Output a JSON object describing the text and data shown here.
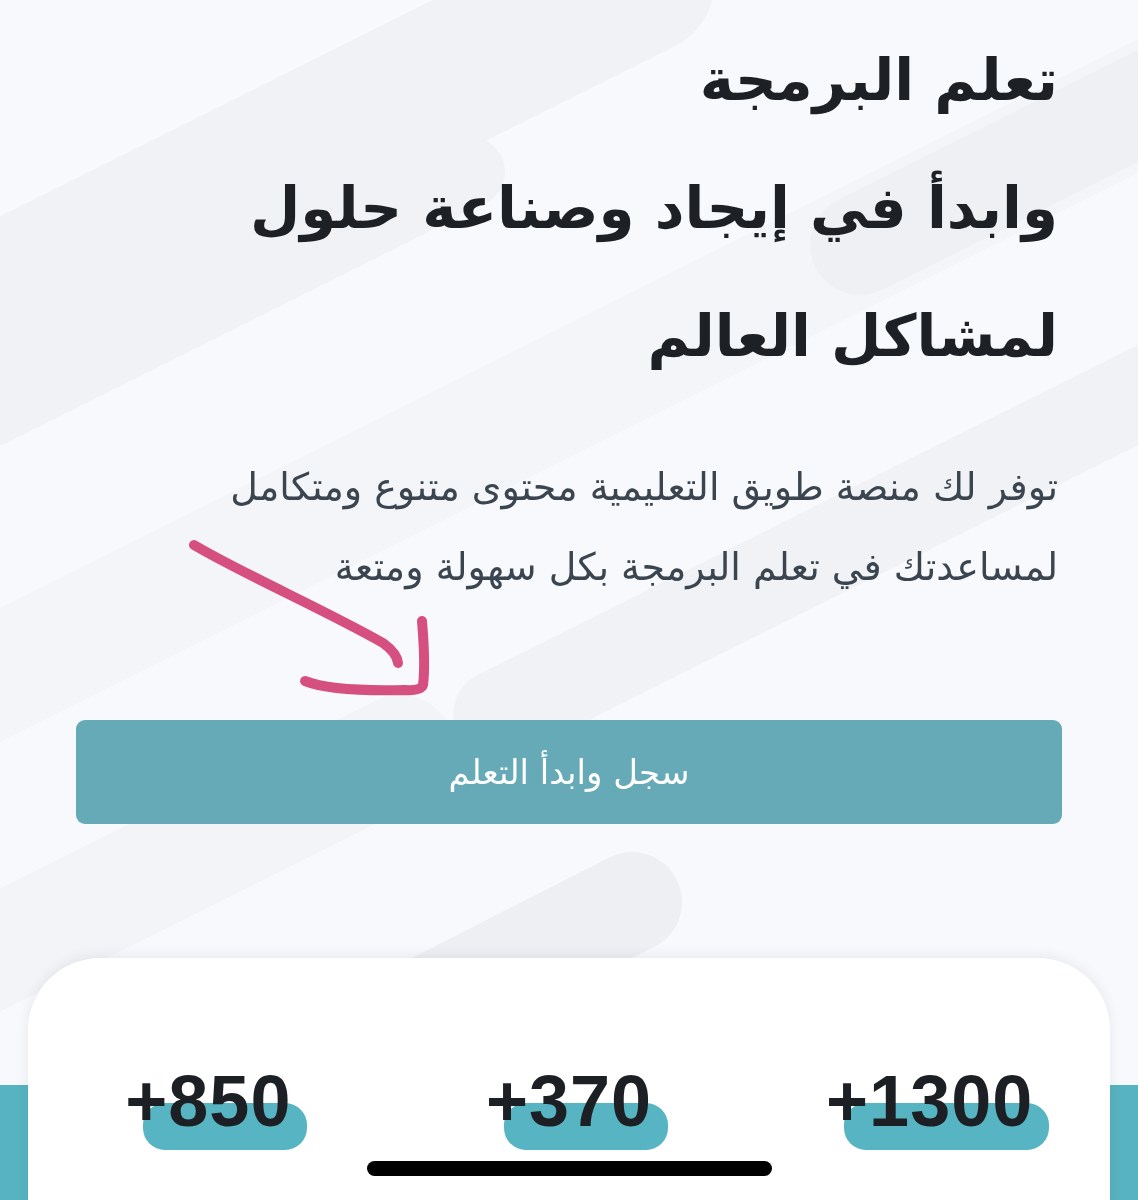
{
  "hero": {
    "title_lines": [
      "تعلم البرمجة",
      "وابدأ في إيجاد وصناعة حلول",
      "لمشاكل العالم"
    ],
    "description_lines": [
      "توفر لك منصة طويق التعليمية محتوى متنوع ومتكامل",
      "لمساعدتك في تعلم البرمجة بكل سهولة ومتعة"
    ]
  },
  "signup_button": {
    "label": "سجل وابدأ التعلم"
  },
  "stats": [
    {
      "value": "+1300"
    },
    {
      "value": "+370"
    },
    {
      "value": "+850"
    }
  ]
}
